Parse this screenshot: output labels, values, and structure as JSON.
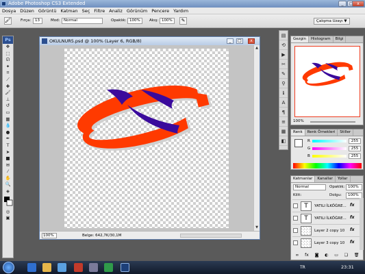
{
  "app": {
    "title": "Adobe Photoshop CS3 Extended",
    "logo": "Ps"
  },
  "menu": [
    "Dosya",
    "Düzen",
    "Görüntü",
    "Katman",
    "Seç",
    "Filtre",
    "Analiz",
    "Görünüm",
    "Pencere",
    "Yardım"
  ],
  "options": {
    "brush_label": "Fırça:",
    "brush_size": "13",
    "mode_label": "Mod:",
    "mode_value": "Normal",
    "opacity_label": "Opaklık:",
    "opacity_value": "100%",
    "flow_label": "Akış:",
    "flow_value": "100%",
    "workspace": "Çalışma Uzayı ▼"
  },
  "document": {
    "title": "OKULNUR5.psd @ 100% (Layer 6, RGB/8)",
    "zoom": "100%",
    "doc_info": "Belge: 642,7K/30,1M"
  },
  "navigator": {
    "tabs": [
      "Gezgin",
      "Histogram",
      "Bilgi"
    ],
    "zoom": "100%"
  },
  "color": {
    "tabs": [
      "Renk",
      "Renk Örnekleri",
      "Stiller"
    ],
    "channels": [
      {
        "label": "R",
        "value": "255",
        "color": "#ff0000"
      },
      {
        "label": "G",
        "value": "255",
        "color": "#00ff00"
      },
      {
        "label": "B",
        "value": "255",
        "color": "#0000ff"
      }
    ]
  },
  "layers": {
    "tabs": [
      "Katmanlar",
      "Kanallar",
      "Yollar"
    ],
    "blend_mode": "Normal",
    "opacity_label": "Opaklık:",
    "opacity_value": "100%",
    "lock_label": "Kilit:",
    "fill_label": "Dolgu:",
    "fill_value": "100%",
    "items": [
      {
        "name": "YATILI İLKÖĞRE...",
        "thumb": "text",
        "fx": "fx"
      },
      {
        "name": "YATILI İLKÖĞRE...",
        "thumb": "text",
        "fx": "fx"
      },
      {
        "name": "Layer 2 copy 10",
        "thumb": "image",
        "fx": "fx"
      },
      {
        "name": "Layer 3 copy 10",
        "thumb": "image",
        "fx": "fx"
      }
    ]
  },
  "taskbar": {
    "language": "TR",
    "clock": "23:31"
  },
  "colors": {
    "orange": "#ff3a00",
    "purple": "#3a0a9c"
  }
}
